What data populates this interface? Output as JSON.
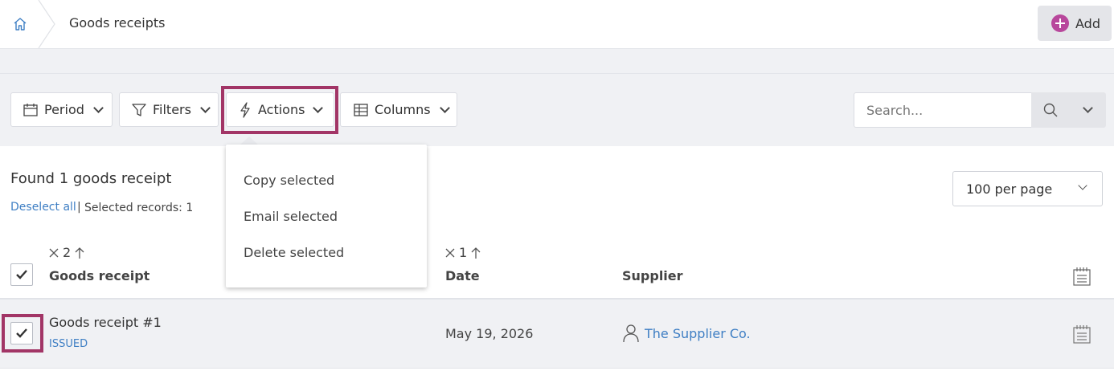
{
  "breadcrumb": {
    "title": "Goods receipts"
  },
  "header": {
    "add_label": "Add"
  },
  "toolbar": {
    "period_label": "Period",
    "filters_label": "Filters",
    "actions_label": "Actions",
    "columns_label": "Columns",
    "search_placeholder": "Search..."
  },
  "actions_menu": {
    "items": [
      "Copy selected",
      "Email selected",
      "Delete selected"
    ]
  },
  "results": {
    "found_text": "Found 1 goods receipt",
    "deselect_label": "Deselect all",
    "separator": "|",
    "selected_text": "Selected records: 1",
    "per_page": "100 per page"
  },
  "table": {
    "sort_goods_receipt": "2",
    "sort_date": "1",
    "columns": [
      "Goods receipt",
      "Date",
      "Supplier"
    ],
    "rows": [
      {
        "name": "Goods receipt #1",
        "status": "ISSUED",
        "date": "May 19, 2026",
        "supplier": "The Supplier Co.",
        "checked": true
      }
    ]
  },
  "colors": {
    "accent": "#b8479c",
    "highlight": "#a23566",
    "link": "#3f7fc4"
  }
}
